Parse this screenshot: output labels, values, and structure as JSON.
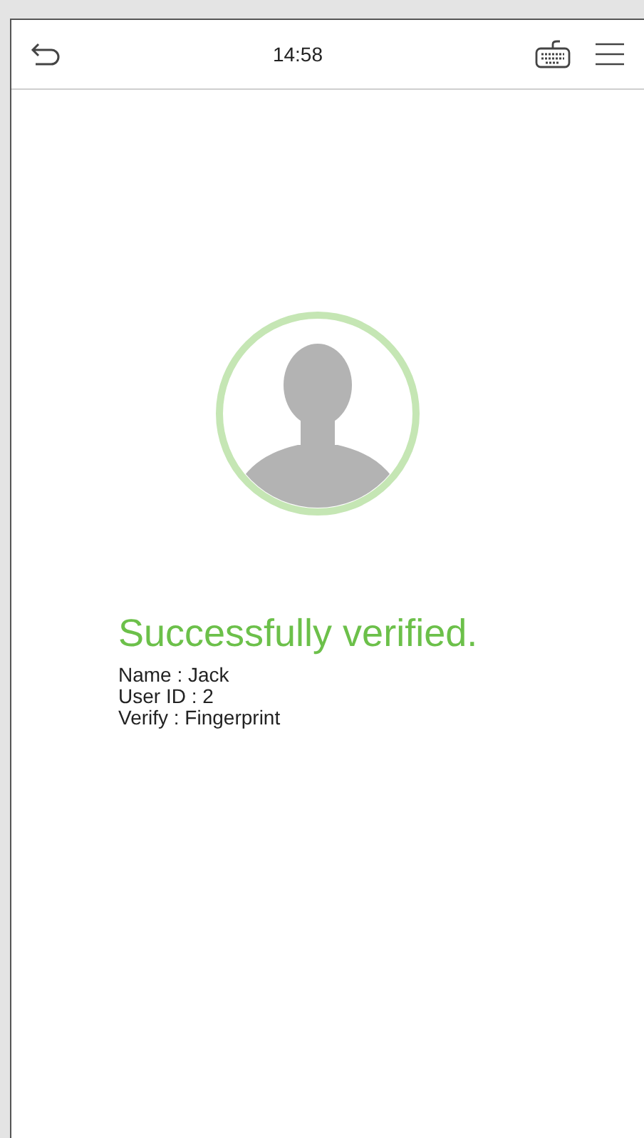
{
  "header": {
    "time": "14:58"
  },
  "result": {
    "title": "Successfully verified.",
    "details": [
      "Name : Jack",
      "User ID : 2",
      "Verify : Fingerprint"
    ]
  }
}
